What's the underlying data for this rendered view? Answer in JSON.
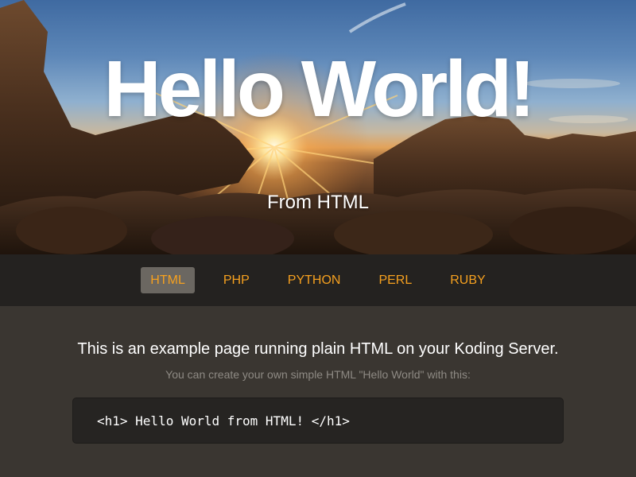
{
  "hero": {
    "title": "Hello World!",
    "subtitle": "From HTML"
  },
  "nav": {
    "items": [
      {
        "label": "HTML",
        "active": true
      },
      {
        "label": "PHP",
        "active": false
      },
      {
        "label": "PYTHON",
        "active": false
      },
      {
        "label": "PERL",
        "active": false
      },
      {
        "label": "RUBY",
        "active": false
      }
    ]
  },
  "content": {
    "lead": "This is an example page running plain HTML on your Koding Server.",
    "hint": "You can create your own simple HTML \"Hello World\" with this:",
    "code": "<h1> Hello World from HTML! </h1>"
  },
  "colors": {
    "accent": "#f5a01f",
    "nav_bg": "#242220",
    "content_bg": "#3a3631",
    "code_bg": "#262422",
    "active_tab_bg": "#6b6761"
  }
}
